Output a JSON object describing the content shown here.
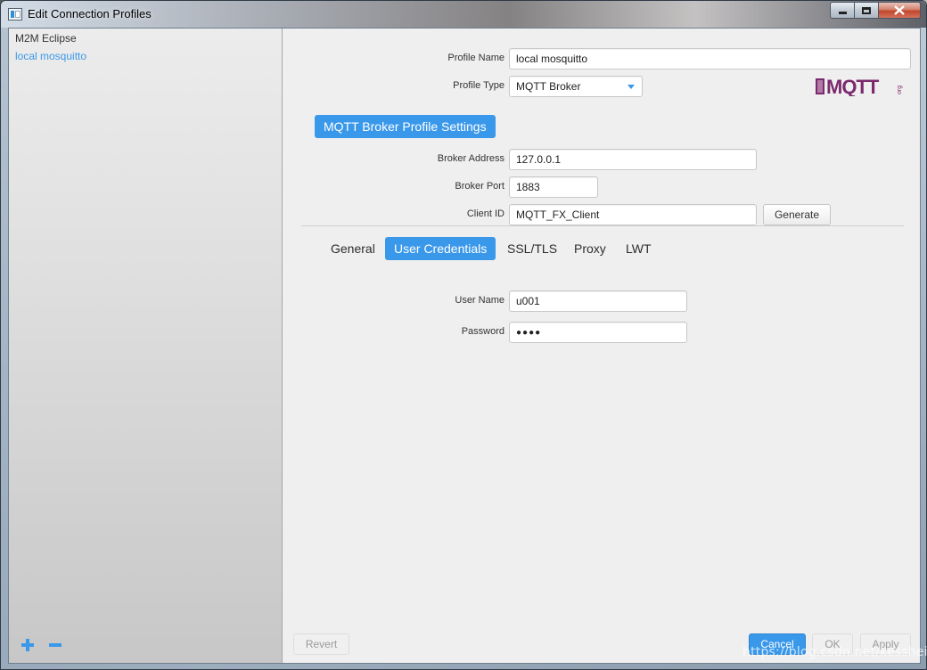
{
  "window": {
    "title": "Edit Connection Profiles"
  },
  "sidebar": {
    "profiles": [
      {
        "label": "M2M Eclipse",
        "selected": false
      },
      {
        "label": "local mosquitto",
        "selected": true
      }
    ],
    "add_icon": "plus-icon",
    "remove_icon": "minus-icon"
  },
  "profile": {
    "name_label": "Profile Name",
    "name_value": "local mosquitto",
    "type_label": "Profile Type",
    "type_value": "MQTT Broker",
    "logo_text": "MQTT",
    "logo_sub": "org"
  },
  "broker": {
    "section_title": "MQTT Broker Profile Settings",
    "address_label": "Broker Address",
    "address_value": "127.0.0.1",
    "port_label": "Broker Port",
    "port_value": "1883",
    "client_id_label": "Client ID",
    "client_id_value": "MQTT_FX_Client",
    "generate_label": "Generate"
  },
  "tabs": [
    {
      "label": "General",
      "active": false
    },
    {
      "label": "User Credentials",
      "active": true
    },
    {
      "label": "SSL/TLS",
      "active": false
    },
    {
      "label": "Proxy",
      "active": false
    },
    {
      "label": "LWT",
      "active": false
    }
  ],
  "credentials": {
    "username_label": "User Name",
    "username_value": "u001",
    "password_label": "Password",
    "password_value": "●●●●"
  },
  "footer": {
    "revert_label": "Revert",
    "cancel_label": "Cancel",
    "ok_label": "OK",
    "apply_label": "Apply"
  },
  "watermark": "https://blog.csdn.net/kesshei",
  "colors": {
    "accent": "#3a98ea",
    "logo_purple": "#7b2a6e"
  }
}
